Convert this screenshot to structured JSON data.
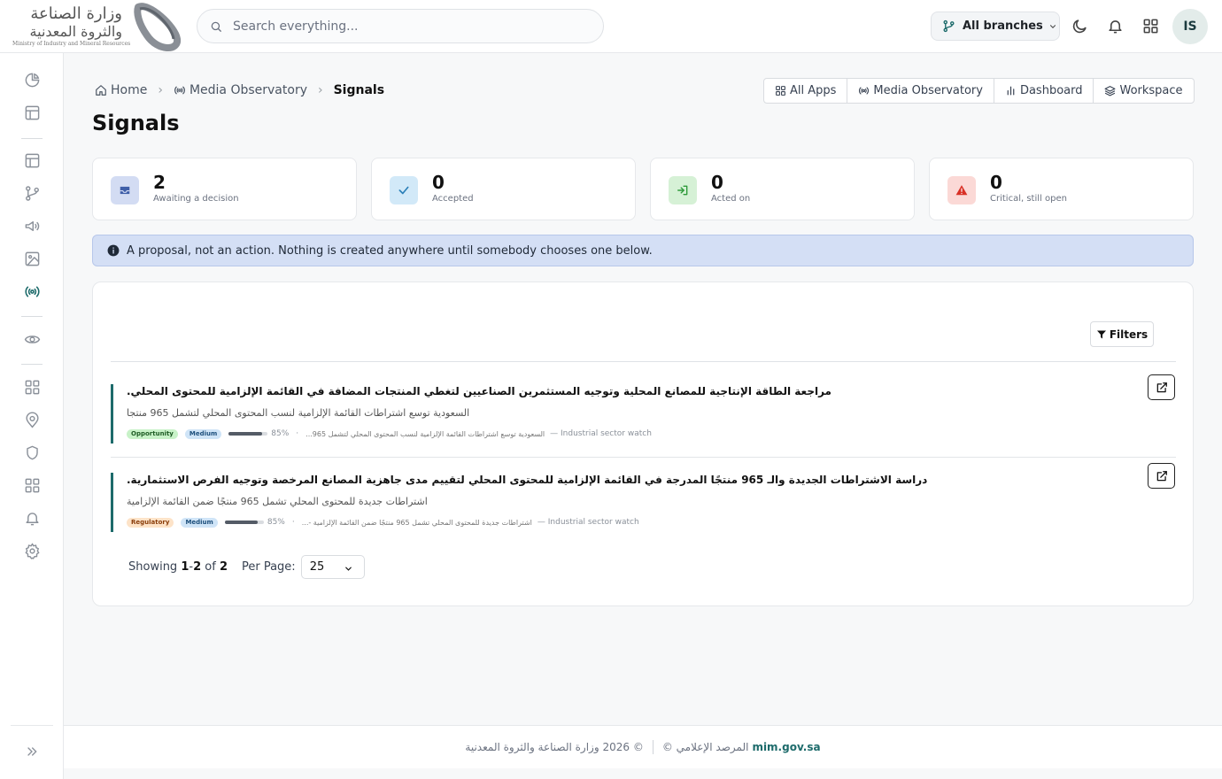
{
  "brand": {
    "ar_line1": "وزارة الصناعة",
    "ar_line2": "والثروة المعدنية",
    "en_name": "Ministry of Industry and Mineral Resources"
  },
  "search": {
    "placeholder": "Search everything..."
  },
  "topbar": {
    "branch_label": "All branches",
    "avatar_initials": "IS",
    "icons": [
      "git-branch-icon",
      "chevron-down-icon",
      "moon-icon",
      "bell-icon",
      "apps-grid-icon"
    ]
  },
  "sidebar": {
    "icons": [
      "pie-chart-icon",
      "layout-icon",
      "layout-icon",
      "git-branch-icon",
      "megaphone-icon",
      "image-icon",
      "broadcast-icon",
      "eye-icon",
      "grid-icon",
      "map-pin-icon",
      "shield-icon",
      "grid-icon",
      "bell-icon",
      "gear-icon",
      "chevrons-right-icon"
    ],
    "active": "broadcast-icon"
  },
  "breadcrumb": {
    "home": "Home",
    "section": "Media Observatory",
    "current": "Signals"
  },
  "applinks": {
    "all_apps": "All Apps",
    "media_observatory": "Media Observatory",
    "dashboard": "Dashboard",
    "workspace": "Workspace"
  },
  "page": {
    "title": "Signals"
  },
  "stats": [
    {
      "value": "2",
      "label": "Awaiting a decision",
      "color": "#3f5fa8"
    },
    {
      "value": "0",
      "label": "Accepted",
      "color": "#2a7fb8"
    },
    {
      "value": "0",
      "label": "Acted on",
      "color": "#2e9a3a"
    },
    {
      "value": "0",
      "label": "Critical, still open",
      "color": "#d93025"
    }
  ],
  "notice": {
    "text": "A proposal, not an action. Nothing is created anywhere until somebody chooses one below."
  },
  "filters": {
    "label": "Filters"
  },
  "signals": [
    {
      "title": "مراجعة الطاقة الإنتاجية للمصانع المحلية وتوجيه المستثمرين الصناعيين لتغطي المنتجات المضافة في القائمة الإلزامية للمحتوى المحلي.",
      "subtitle": "السعودية توسع اشتراطات القائمة الإلزامية لنسب المحتوى المحلي لتشمل 965 منتجا",
      "type": "Opportunity",
      "severity": "Medium",
      "confidence": 0.85,
      "confidence_label": "85%",
      "source_title": "السعودية توسع اشتراطات القائمة الإلزامية لنسب المحتوى المحلي لتشمل 965...",
      "source": "— Industrial sector watch"
    },
    {
      "title": "دراسة الاشتراطات الجديدة والـ 965 منتجًا المدرجة في القائمة الإلزامية للمحتوى المحلي لتقييم مدى جاهزية المصانع المرخصة وتوجيه الفرص الاستثمارية.",
      "subtitle": "اشتراطات جديدة للمحتوى المحلي تشمل 965 منتجًا ضمن القائمة الإلزامية",
      "type": "Regulatory",
      "severity": "Medium",
      "confidence": 0.85,
      "confidence_label": "85%",
      "source_title": "اشتراطات جديدة للمحتوى المحلي تشمل 965 منتجًا ضمن القائمة الإلزامية -...",
      "source": "— Industrial sector watch"
    }
  ],
  "pagination": {
    "showing": "Showing",
    "range_start": "1",
    "range_sep": "-",
    "range_end": "2",
    "of": "of",
    "total": "2",
    "per_page_label": "Per Page:",
    "per_page_value": "25"
  },
  "footer": {
    "org_text": "© 2026 وزارة الصناعة والثروة المعدنية",
    "product_text": "المرصد الإعلامي ©",
    "link": "mim.gov.sa"
  }
}
